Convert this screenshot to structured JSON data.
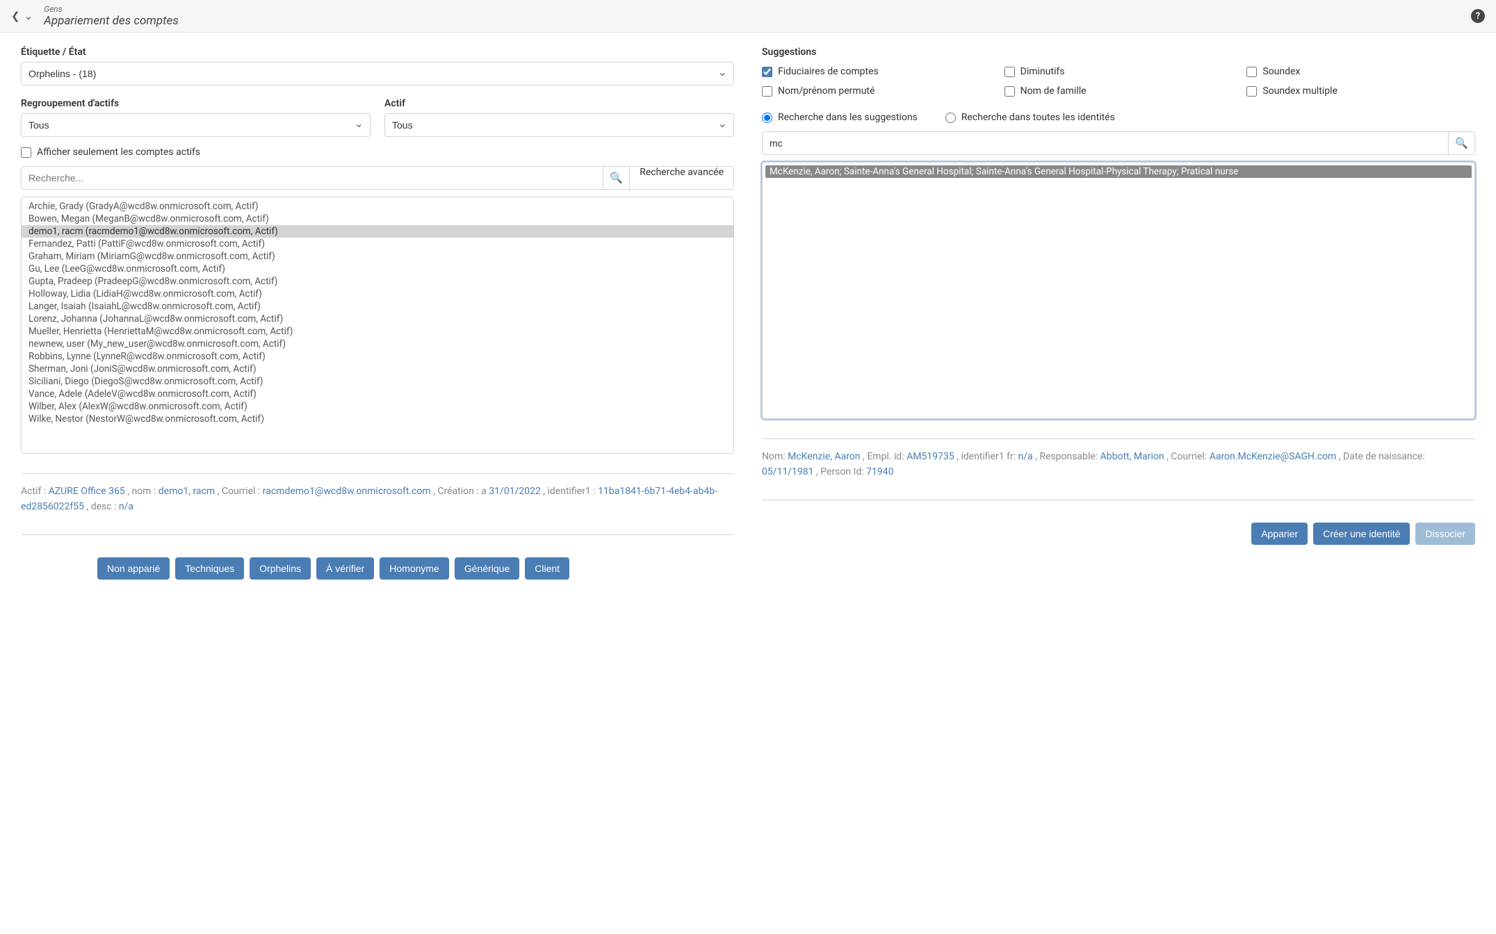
{
  "header": {
    "breadcrumb": "Gens",
    "title": "Appariement des comptes"
  },
  "left": {
    "section_label": "Étiquette / État",
    "etiquette_value": "Orphelins - (18)",
    "regroup_label": "Regroupement d'actifs",
    "regroup_value": "Tous",
    "actif_label": "Actif",
    "actif_value": "Tous",
    "active_only_label": "Afficher seulement les comptes actifs",
    "search_placeholder": "Recherche...",
    "search_adv_label": "Recherche avancée",
    "accounts": [
      {
        "text": "Archie, Grady (GradyA@wcd8w.onmicrosoft.com, Actif)",
        "selected": false
      },
      {
        "text": "Bowen, Megan (MeganB@wcd8w.onmicrosoft.com, Actif)",
        "selected": false
      },
      {
        "text": "demo1, racm (racmdemo1@wcd8w.onmicrosoft.com, Actif)",
        "selected": true
      },
      {
        "text": "Fernandez, Patti (PattiF@wcd8w.onmicrosoft.com, Actif)",
        "selected": false
      },
      {
        "text": "Graham, Miriam (MiriamG@wcd8w.onmicrosoft.com, Actif)",
        "selected": false
      },
      {
        "text": "Gu, Lee (LeeG@wcd8w.onmicrosoft.com, Actif)",
        "selected": false
      },
      {
        "text": "Gupta, Pradeep (PradeepG@wcd8w.onmicrosoft.com, Actif)",
        "selected": false
      },
      {
        "text": "Holloway, Lidia (LidiaH@wcd8w.onmicrosoft.com, Actif)",
        "selected": false
      },
      {
        "text": "Langer, Isaiah (IsaiahL@wcd8w.onmicrosoft.com, Actif)",
        "selected": false
      },
      {
        "text": "Lorenz, Johanna (JohannaL@wcd8w.onmicrosoft.com, Actif)",
        "selected": false
      },
      {
        "text": "Mueller, Henrietta (HenriettaM@wcd8w.onmicrosoft.com, Actif)",
        "selected": false
      },
      {
        "text": "newnew, user (My_new_user@wcd8w.onmicrosoft.com, Actif)",
        "selected": false
      },
      {
        "text": "Robbins, Lynne (LynneR@wcd8w.onmicrosoft.com, Actif)",
        "selected": false
      },
      {
        "text": "Sherman, Joni (JoniS@wcd8w.onmicrosoft.com, Actif)",
        "selected": false
      },
      {
        "text": "Siciliani, Diego (DiegoS@wcd8w.onmicrosoft.com, Actif)",
        "selected": false
      },
      {
        "text": "Vance, Adele (AdeleV@wcd8w.onmicrosoft.com, Actif)",
        "selected": false
      },
      {
        "text": "Wilber, Alex (AlexW@wcd8w.onmicrosoft.com, Actif)",
        "selected": false
      },
      {
        "text": "Wilke, Nestor (NestorW@wcd8w.onmicrosoft.com, Actif)",
        "selected": false
      }
    ],
    "detail": {
      "actif_lbl": "Actif : ",
      "actif_val": "AZURE Office 365",
      "nom_lbl": ", nom : ",
      "nom_val": "demo1, racm",
      "email_lbl": ", Courriel : ",
      "email_val": "racmdemo1@wcd8w.onmicrosoft.com",
      "creation_lbl": ", Création : a ",
      "creation_val": "31/01/2022",
      "id1_lbl": ", identifier1 : ",
      "id1_val": "11ba1841-6b71-4eb4-ab4b-ed2856022f55",
      "desc_lbl": ", desc : ",
      "desc_val": "n/a"
    },
    "buttons": [
      "Non apparié",
      "Techniques",
      "Orphelins",
      "À vérifier",
      "Homonyme",
      "Générique",
      "Client"
    ]
  },
  "right": {
    "section_label": "Suggestions",
    "options": [
      {
        "label": "Fiduciaires de comptes",
        "checked": true
      },
      {
        "label": "Diminutifs",
        "checked": false
      },
      {
        "label": "Soundex",
        "checked": false
      },
      {
        "label": "Nom/prénom permuté",
        "checked": false
      },
      {
        "label": "Nom de famille",
        "checked": false
      },
      {
        "label": "Soundex multiple",
        "checked": false
      }
    ],
    "radio": {
      "sugg": "Recherche dans les suggestions",
      "all": "Recherche dans toutes les identités"
    },
    "search_value": "mc",
    "suggestion_item": "McKenzie, Aaron; Sainte-Anna's General Hospital; Sainte-Anna's General Hospital-Physical Therapy; Pratical nurse",
    "detail": {
      "nom_lbl": "Nom: ",
      "nom_val": "McKenzie, Aaron",
      "emp_lbl": ", Empl. id: ",
      "emp_val": "AM519735",
      "idfr_lbl": ", identifier1 fr: ",
      "idfr_val": "n/a",
      "resp_lbl": ", Responsable: ",
      "resp_val": "Abbott, Marion",
      "email_lbl": ", Courriel: ",
      "email_val": "Aaron.McKenzie@SAGH.com",
      "dob_lbl": ", Date de naissance: ",
      "dob_val": "05/11/1981",
      "pid_lbl": ", Person Id: ",
      "pid_val": "71940"
    },
    "buttons": {
      "apparier": "Apparier",
      "creer": "Créer une identité",
      "dissocier": "Dissocier"
    }
  }
}
